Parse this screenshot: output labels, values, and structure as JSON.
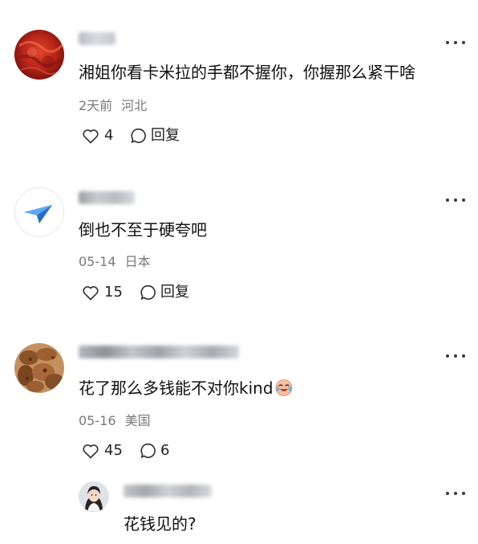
{
  "comments": [
    {
      "text": "湘姐你看卡米拉的手都不握你，你握那么紧干啥",
      "time": "2天前",
      "location": "河北",
      "likes": "4",
      "reply_label": "回复",
      "avatar": "red-abstract-avatar"
    },
    {
      "text": "倒也不至于硬夸吧",
      "time": "05-14",
      "location": "日本",
      "likes": "15",
      "reply_label": "回复",
      "avatar": "paper-plane-avatar"
    },
    {
      "text": "花了那么多钱能不对你kind",
      "time": "05-16",
      "location": "美国",
      "likes": "45",
      "reply_count": "6",
      "emoji": "crying-laughing-face",
      "avatar": "snack-food-avatar"
    }
  ],
  "reply": {
    "text": "花钱见的?",
    "avatar": "girl-portrait-avatar"
  },
  "colors": {
    "text": "#111111",
    "meta": "#7a7a7a",
    "icon": "#333333"
  }
}
